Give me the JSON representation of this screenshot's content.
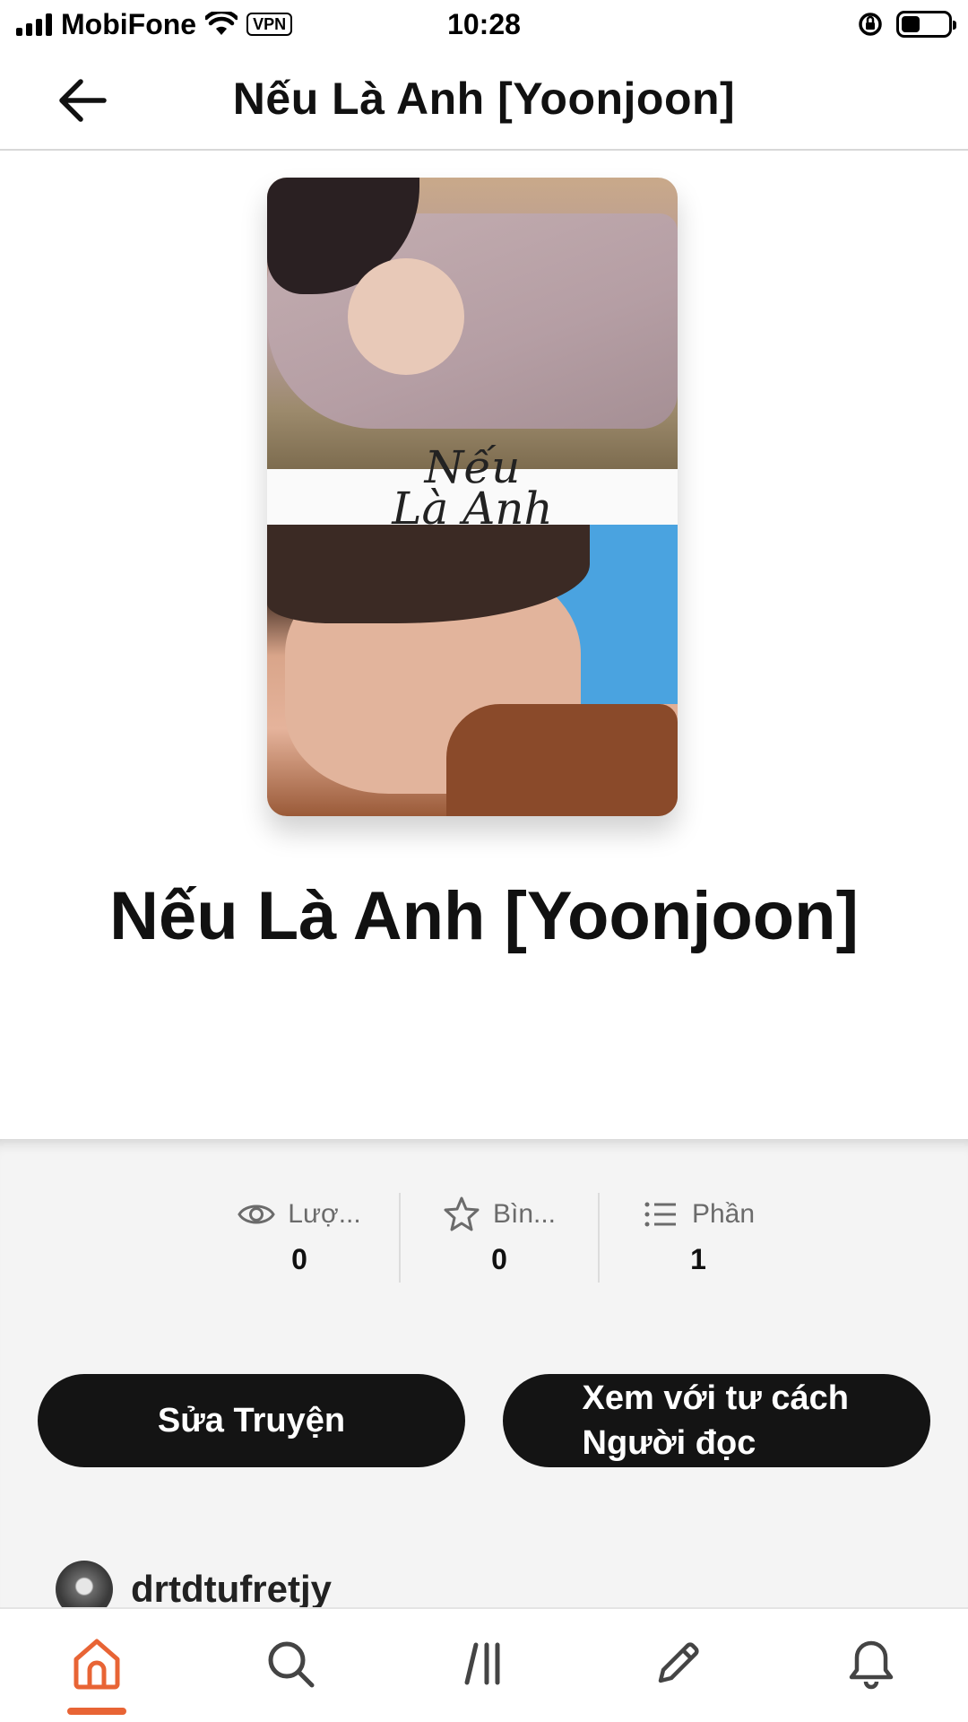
{
  "status_bar": {
    "carrier": "MobiFone",
    "vpn": "VPN",
    "time": "10:28"
  },
  "header": {
    "title": "Nếu Là Anh [Yoonjoon]"
  },
  "cover": {
    "overlay_text_line1": "Nếu",
    "overlay_text_line2": "Là Anh"
  },
  "story": {
    "title": "Nếu Là Anh [Yoonjoon]"
  },
  "stats": [
    {
      "icon": "eye-icon",
      "label": "Lượ...",
      "value": "0"
    },
    {
      "icon": "star-icon",
      "label": "Bìn...",
      "value": "0"
    },
    {
      "icon": "list-icon",
      "label": "Phần",
      "value": "1"
    }
  ],
  "actions": {
    "edit_label": "Sửa Truyện",
    "preview_label": "Xem với tư cách Người đọc"
  },
  "author": {
    "name": "drtdtufretjy"
  },
  "bottom_nav": [
    {
      "icon": "home-icon",
      "active": true
    },
    {
      "icon": "search-icon",
      "active": false
    },
    {
      "icon": "library-icon",
      "active": false
    },
    {
      "icon": "pencil-icon",
      "active": false
    },
    {
      "icon": "bell-icon",
      "active": false
    }
  ],
  "colors": {
    "accent": "#e86435",
    "button_bg": "#141414",
    "section_bg": "#f4f4f4"
  }
}
